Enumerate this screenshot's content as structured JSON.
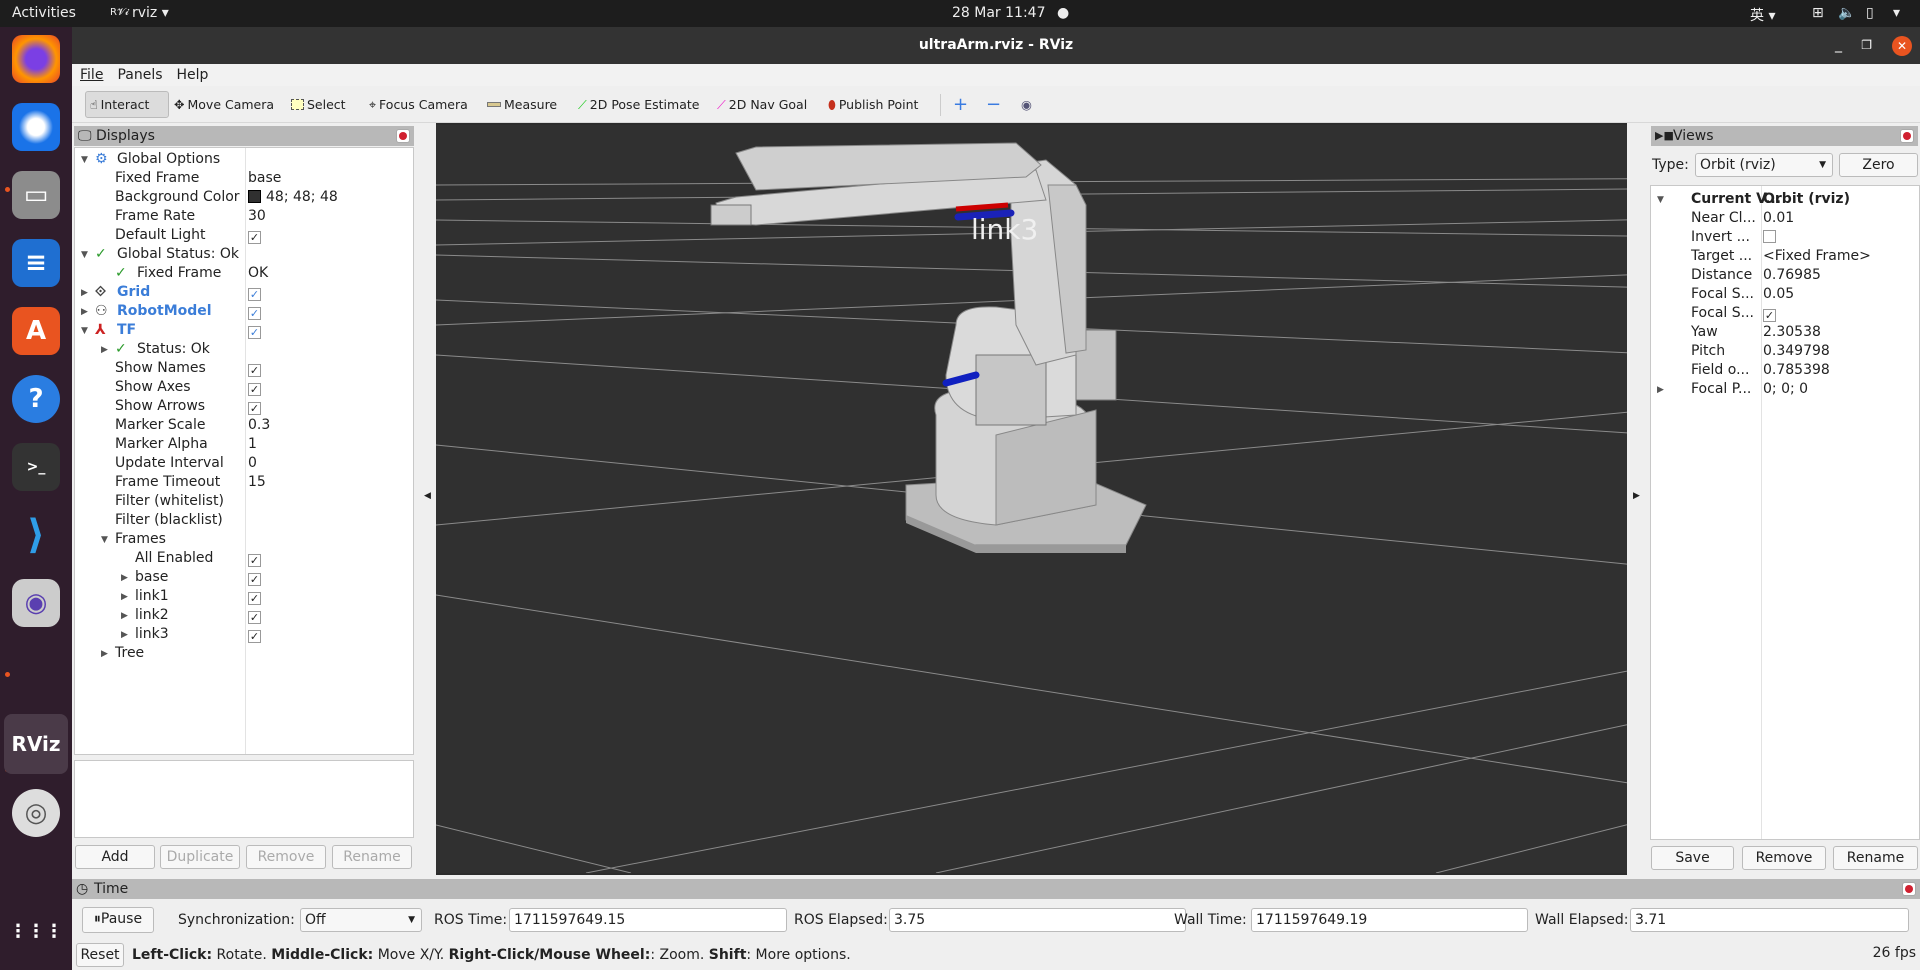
{
  "topbar": {
    "activities": "Activities",
    "app": "rviz",
    "clock": "28 Mar  11:47",
    "input_method": "英"
  },
  "window": {
    "title": "ultraArm.rviz - RViz"
  },
  "menu": [
    "File",
    "Panels",
    "Help"
  ],
  "toolbar": {
    "tools": [
      "Interact",
      "Move Camera",
      "Select",
      "Focus Camera",
      "Measure",
      "2D Pose Estimate",
      "2D Nav Goal",
      "Publish Point"
    ],
    "active": "Interact"
  },
  "displays": {
    "title": "Displays",
    "rows": [
      {
        "label": "Global Options",
        "value": "",
        "indent": 0,
        "icon": "gear-icon",
        "expand": "open"
      },
      {
        "label": "Fixed Frame",
        "value": "base",
        "indent": 1
      },
      {
        "label": "Background Color",
        "value": "48; 48; 48",
        "indent": 1,
        "swatch": "#303030"
      },
      {
        "label": "Frame Rate",
        "value": "30",
        "indent": 1
      },
      {
        "label": "Default Light",
        "value": "",
        "check": true,
        "indent": 1
      },
      {
        "label": "Global Status: Ok",
        "value": "",
        "indent": 0,
        "icon": "check-icon",
        "expand": "open"
      },
      {
        "label": "Fixed Frame",
        "value": "OK",
        "indent": 1,
        "icon": "check-icon"
      },
      {
        "label": "Grid",
        "value": "",
        "check": true,
        "indent": 0,
        "icon": "grid-icon",
        "expand": "closed",
        "blue": true
      },
      {
        "label": "RobotModel",
        "value": "",
        "check": true,
        "indent": 0,
        "icon": "robot-icon",
        "expand": "closed",
        "blue": true
      },
      {
        "label": "TF",
        "value": "",
        "check": true,
        "indent": 0,
        "icon": "tf-axes-icon",
        "expand": "open",
        "blue": true
      },
      {
        "label": "Status: Ok",
        "value": "",
        "indent": 1,
        "icon": "check-icon",
        "expand": "closed"
      },
      {
        "label": "Show Names",
        "value": "",
        "check": true,
        "indent": 1
      },
      {
        "label": "Show Axes",
        "value": "",
        "check": true,
        "indent": 1
      },
      {
        "label": "Show Arrows",
        "value": "",
        "check": true,
        "indent": 1
      },
      {
        "label": "Marker Scale",
        "value": "0.3",
        "indent": 1
      },
      {
        "label": "Marker Alpha",
        "value": "1",
        "indent": 1
      },
      {
        "label": "Update Interval",
        "value": "0",
        "indent": 1
      },
      {
        "label": "Frame Timeout",
        "value": "15",
        "indent": 1
      },
      {
        "label": "Filter (whitelist)",
        "value": "",
        "indent": 1
      },
      {
        "label": "Filter (blacklist)",
        "value": "",
        "indent": 1
      },
      {
        "label": "Frames",
        "value": "",
        "indent": 1,
        "expand": "open"
      },
      {
        "label": "All Enabled",
        "value": "",
        "check": true,
        "indent": 2
      },
      {
        "label": "base",
        "value": "",
        "check": true,
        "indent": 2,
        "expand": "closed"
      },
      {
        "label": "link1",
        "value": "",
        "check": true,
        "indent": 2,
        "expand": "closed"
      },
      {
        "label": "link2",
        "value": "",
        "check": true,
        "indent": 2,
        "expand": "closed"
      },
      {
        "label": "link3",
        "value": "",
        "check": true,
        "indent": 2,
        "expand": "closed"
      },
      {
        "label": "Tree",
        "value": "",
        "indent": 1,
        "expand": "closed"
      }
    ],
    "buttons": {
      "add": "Add",
      "duplicate": "Duplicate",
      "remove": "Remove",
      "rename": "Rename"
    }
  },
  "scene": {
    "frame_label": "link3",
    "background": "#303030"
  },
  "views": {
    "title": "Views",
    "type_label": "Type:",
    "type_value": "Orbit (rviz)",
    "zero": "Zero",
    "rows": [
      {
        "label": "Current V...",
        "value": "Orbit (rviz)",
        "bold": true,
        "expand": "open"
      },
      {
        "label": "Near Cl...",
        "value": "0.01"
      },
      {
        "label": "Invert ...",
        "value": "",
        "check": false
      },
      {
        "label": "Target ...",
        "value": "<Fixed Frame>"
      },
      {
        "label": "Distance",
        "value": "0.76985"
      },
      {
        "label": "Focal S...",
        "value": "0.05"
      },
      {
        "label": "Focal S...",
        "value": "",
        "check": true
      },
      {
        "label": "Yaw",
        "value": "2.30538"
      },
      {
        "label": "Pitch",
        "value": "0.349798"
      },
      {
        "label": "Field o...",
        "value": "0.785398"
      },
      {
        "label": "Focal P...",
        "value": "0; 0; 0",
        "expand": "closed"
      }
    ],
    "buttons": {
      "save": "Save",
      "remove": "Remove",
      "rename": "Rename"
    }
  },
  "time": {
    "title": "Time",
    "pause": "Pause",
    "sync_label": "Synchronization:",
    "sync_value": "Off",
    "ros_time_label": "ROS Time:",
    "ros_time": "1711597649.15",
    "ros_elapsed_label": "ROS Elapsed:",
    "ros_elapsed": "3.75",
    "wall_time_label": "Wall Time:",
    "wall_time": "1711597649.19",
    "wall_elapsed_label": "Wall Elapsed:",
    "wall_elapsed": "3.71"
  },
  "status": {
    "reset": "Reset",
    "hints": [
      {
        "b": "Left-Click:",
        "t": " Rotate. "
      },
      {
        "b": "Middle-Click:",
        "t": " Move X/Y. "
      },
      {
        "b": "Right-Click/Mouse Wheel:",
        "t": ": Zoom. "
      },
      {
        "b": "Shift",
        "t": ": More options."
      }
    ],
    "fps": "26 fps"
  }
}
